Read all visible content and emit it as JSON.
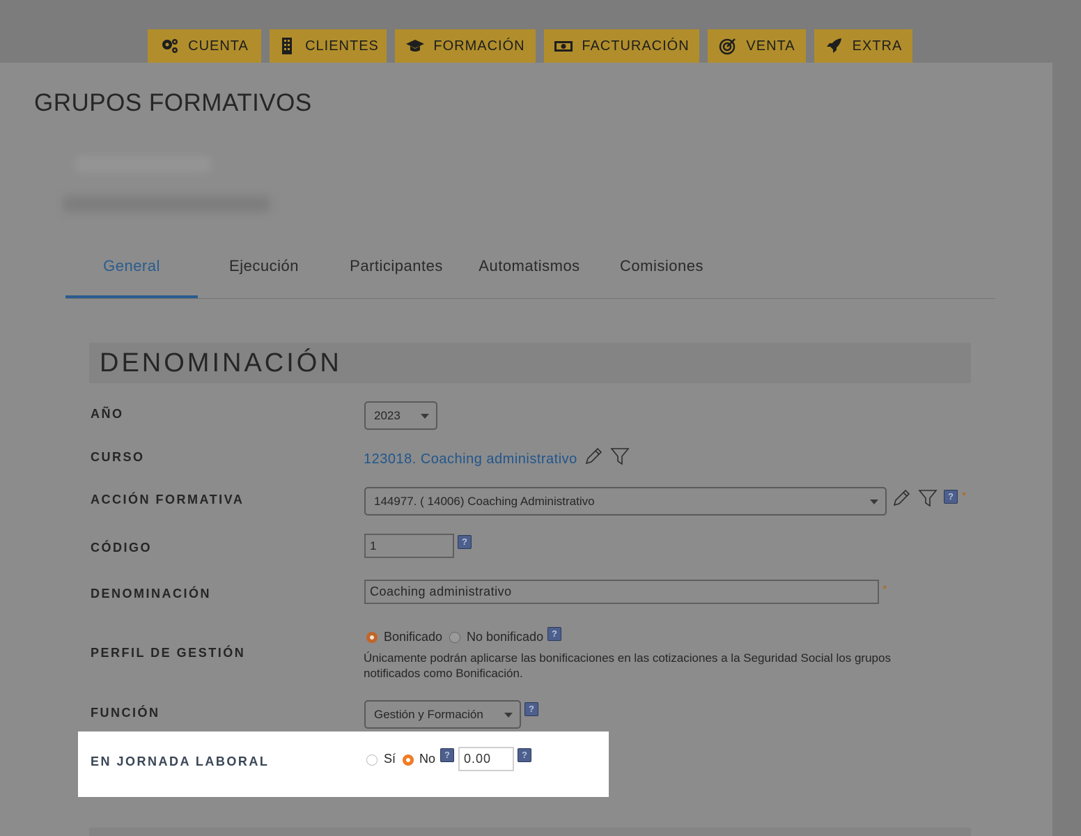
{
  "nav": {
    "items": [
      {
        "label": "CUENTA",
        "icon": "gears-icon"
      },
      {
        "label": "CLIENTES",
        "icon": "building-icon"
      },
      {
        "label": "FORMACIÓN",
        "icon": "graduation-cap-icon"
      },
      {
        "label": "FACTURACIÓN",
        "icon": "money-bill-icon"
      },
      {
        "label": "VENTA",
        "icon": "target-icon"
      },
      {
        "label": "EXTRA",
        "icon": "rocket-icon"
      }
    ]
  },
  "page": {
    "title": "GRUPOS FORMATIVOS"
  },
  "tabs": [
    {
      "label": "General",
      "active": true
    },
    {
      "label": "Ejecución"
    },
    {
      "label": "Participantes"
    },
    {
      "label": "Automatismos"
    },
    {
      "label": "Comisiones"
    }
  ],
  "section": {
    "title": "DENOMINACIÓN"
  },
  "form": {
    "anio": {
      "label": "AÑO",
      "value": "2023"
    },
    "curso": {
      "label": "CURSO",
      "value": "123018. Coaching administrativo"
    },
    "accion": {
      "label": "ACCIÓN FORMATIVA",
      "value": "144977. ( 14006) Coaching Administrativo"
    },
    "codigo": {
      "label": "CÓDIGO",
      "value": "1"
    },
    "denominacion": {
      "label": "DENOMINACIÓN",
      "value": "Coaching administrativo"
    },
    "perfil": {
      "label": "PERFIL DE GESTIÓN",
      "options": [
        "Bonificado",
        "No bonificado"
      ],
      "selected": "Bonificado",
      "note": "Únicamente podrán aplicarse las bonificaciones en las cotizaciones a la Seguridad Social los grupos notificados como Bonificación."
    },
    "funcion": {
      "label": "FUNCIÓN",
      "value": "Gestión y Formación"
    },
    "jornada": {
      "label": "EN JORNADA LABORAL",
      "options": [
        "Sí",
        "No"
      ],
      "selected": "No",
      "value": "0.00"
    }
  },
  "help_glyph": "?",
  "required_mark": "*",
  "colors": {
    "nav_button": "#b18e2b",
    "link": "#21568c",
    "accent": "#f07c24"
  }
}
